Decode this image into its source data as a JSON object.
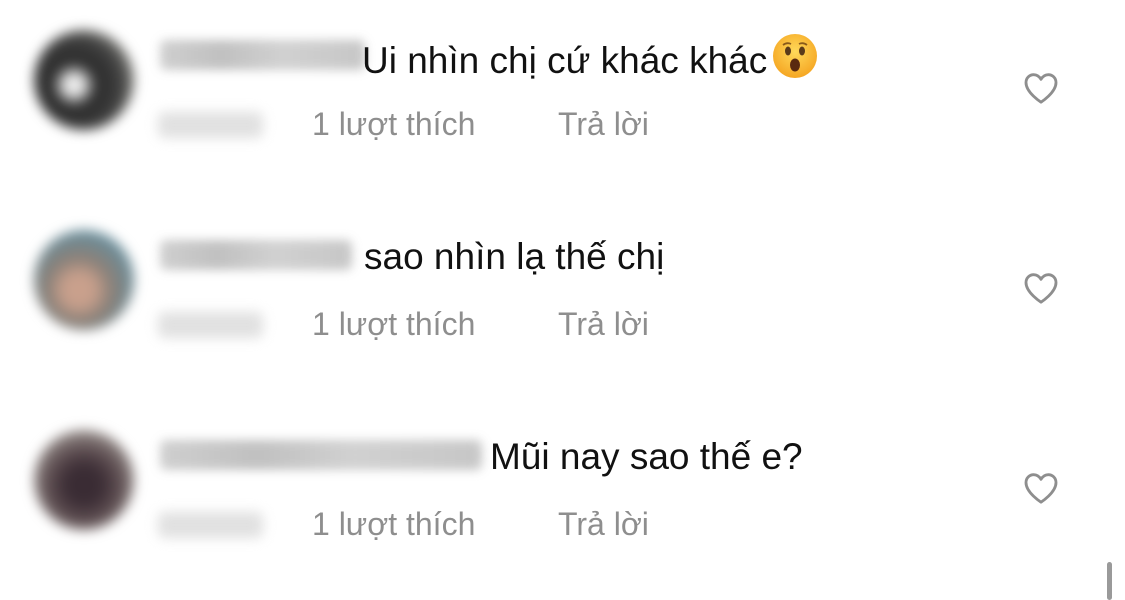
{
  "comments": [
    {
      "text": "Ui nhìn chị cứ khác khác",
      "emoji": "astonished-face-icon",
      "likes": "1 lượt thích",
      "reply": "Trả lời"
    },
    {
      "text": "sao nhìn lạ thế chị",
      "likes": "1 lượt thích",
      "reply": "Trả lời"
    },
    {
      "text": "Mũi nay sao thế e?",
      "likes": "1 lượt thích",
      "reply": "Trả lời"
    }
  ],
  "colors": {
    "text": "#111111",
    "meta": "#8e8e8e",
    "heart_stroke": "#8e8e8e",
    "background": "#ffffff"
  }
}
